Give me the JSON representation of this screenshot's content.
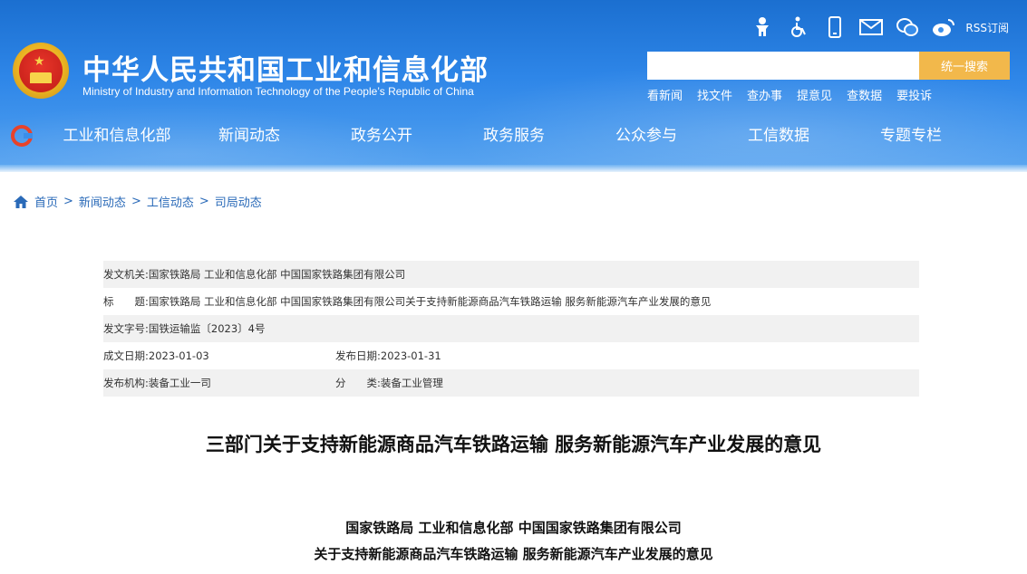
{
  "header": {
    "title_cn": "中华人民共和国工业和信息化部",
    "title_en": "Ministry of Industry and Information Technology of the People’s Republic of China",
    "top_icons": [
      "accessibility-icon",
      "wheelchair-icon",
      "mobile-icon",
      "mail-icon",
      "wechat-icon",
      "weibo-icon"
    ],
    "rss_label": "RSS订阅",
    "search": {
      "placeholder": "",
      "button_label": "统一搜索"
    },
    "quick_links": [
      "看新闻",
      "找文件",
      "查办事",
      "提意见",
      "查数据",
      "要投诉"
    ],
    "colors": {
      "header_blue": "#2e86e8",
      "search_button": "#f2b84b"
    }
  },
  "nav": {
    "items": [
      "工业和信息化部",
      "新闻动态",
      "政务公开",
      "政务服务",
      "公众参与",
      "工信数据",
      "专题专栏"
    ]
  },
  "breadcrumb": {
    "items": [
      "首页",
      "新闻动态",
      "工信动态",
      "司局动态"
    ],
    "separator": ">"
  },
  "meta": {
    "issuer_label": "发文机关:",
    "issuer_value": "国家铁路局 工业和信息化部 中国国家铁路集团有限公司",
    "title_label": "标　　题:",
    "title_value": "国家铁路局 工业和信息化部 中国国家铁路集团有限公司关于支持新能源商品汽车铁路运输 服务新能源汽车产业发展的意见",
    "docno_label": "发文字号:",
    "docno_value": "国铁运输监〔2023〕4号",
    "created_label": "成文日期:",
    "created_value": "2023-01-03",
    "published_label": "发布日期:",
    "published_value": "2023-01-31",
    "agency_label": "发布机构:",
    "agency_value": "装备工业一司",
    "category_label": "分　　类:",
    "category_value": "装备工业管理"
  },
  "article": {
    "title": "三部门关于支持新能源商品汽车铁路运输 服务新能源汽车产业发展的意见",
    "issuers": "国家铁路局 工业和信息化部 中国国家铁路集团有限公司",
    "subtitle": "关于支持新能源商品汽车铁路运输 服务新能源汽车产业发展的意见"
  }
}
